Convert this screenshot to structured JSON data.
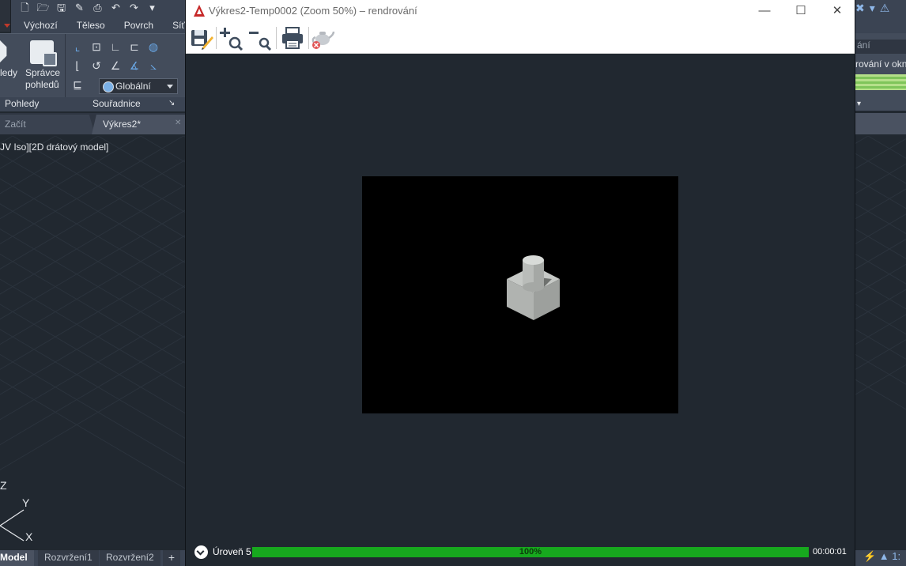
{
  "background_app": {
    "quick_access_icons": [
      "new-file-icon",
      "open-folder-icon",
      "save-icon",
      "save-as-icon",
      "print-icon",
      "undo-icon",
      "redo-icon",
      "customize-icon"
    ],
    "ribbon_tabs": [
      "Výchozí",
      "Těleso",
      "Povrch",
      "Síť"
    ],
    "views_panel": {
      "cut_label": "ledy",
      "view_manager_label": "Správce pohledů",
      "panel_label": "Pohledy"
    },
    "coords_panel": {
      "ucs_value": "Globální",
      "panel_label": "Souřadnice"
    },
    "doc_tabs": {
      "start": "Začít",
      "active": "Výkres2*"
    },
    "viewport_label": "JV Iso][2D drátový model]",
    "ucs": {
      "z": "Z",
      "y": "Y",
      "x": "X"
    },
    "layout_tabs": {
      "model": "Model",
      "layout1": "Rozvržení1",
      "layout2": "Rozvržení2",
      "add": "+"
    },
    "right_panel": {
      "label": "rování v okn",
      "cut_text": "ání"
    }
  },
  "render_window": {
    "title": "Výkres2-Temp0002 (Zoom 50%) – rendrování",
    "controls": {
      "minimize": "—",
      "maximize": "☐",
      "close": "✕"
    },
    "toolbar": [
      "save-render-icon",
      "zoom-in-icon",
      "zoom-out-icon",
      "print-icon",
      "teapot-render-icon"
    ],
    "status": {
      "level": "Úroveň 5",
      "progress_percent": 100,
      "progress_text": "100%",
      "elapsed": "00:00:01"
    }
  },
  "colors": {
    "progress": "#17a81e",
    "app_background": "#212830",
    "logo": "#c62828"
  }
}
